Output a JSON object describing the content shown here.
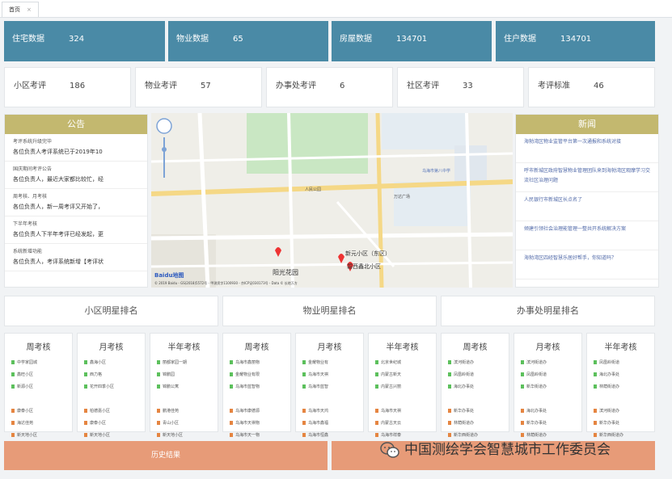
{
  "tab": {
    "label": "首页",
    "close": "×"
  },
  "stats": [
    {
      "label": "住宅数据",
      "value": "324"
    },
    {
      "label": "物业数据",
      "value": "65"
    },
    {
      "label": "房屋数据",
      "value": "134701"
    },
    {
      "label": "住户数据",
      "value": "134701"
    }
  ],
  "ratings": [
    {
      "label": "小区考评",
      "value": "186"
    },
    {
      "label": "物业考评",
      "value": "57"
    },
    {
      "label": "办事处考评",
      "value": "6"
    },
    {
      "label": "社区考评",
      "value": "33"
    },
    {
      "label": "考评标准",
      "value": "46"
    }
  ],
  "notice": {
    "title": "公告",
    "items": [
      {
        "title": "考评系统升级完毕",
        "desc": "各位负责人考评系统已于2019年10"
      },
      {
        "title": "国庆期间考评公告",
        "desc": "各位负责人，最近大家都比较忙，经"
      },
      {
        "title": "周考核、月考核",
        "desc": "各位负责人，新一周考评又开始了，"
      },
      {
        "title": "下半年考核",
        "desc": "各位负责人下半年考评已经发起，更"
      },
      {
        "title": "系统新增功能",
        "desc": "各位负责人，考评系统新增【考评状"
      }
    ]
  },
  "news": {
    "title": "新闻",
    "items": [
      "海勃湾区物业监管平台第一次通报和系统对接",
      "呼市新城区政府智慧物业管理团队来到海勃湾区观摩学习交流社区治理问题",
      "人民银行市新城区长点名了",
      "倾建引领社会治理能管理一整共开系统解决方案",
      "海勃湾区四经智慧乐居好帮手，你知道吗？"
    ]
  },
  "map": {
    "labels": [
      "阳光花园",
      "新元小区（东区）",
      "碧西鑫北小区",
      "乌海市第八中学",
      "万达广场",
      "人民公园"
    ],
    "copyright": "© 2019 Baidu - GS(2018)5572号 - 甲测资字1100930 - 京ICP证030173号 - Data © 长地万方",
    "logo": "Baidu地图"
  },
  "rank_heads": [
    "小区明星排名",
    "物业明星排名",
    "办事处明星排名"
  ],
  "rank_cols": [
    {
      "title": "周考核",
      "top": [
        "中学家园城",
        "鑫旺小区",
        "新源小区"
      ],
      "bottom": [
        "康泰小区",
        "海达佳苑",
        "新天地小区"
      ]
    },
    {
      "title": "月考核",
      "top": [
        "鑫海小区",
        "西力格",
        "花开四季小区"
      ],
      "bottom": [
        "柏德嘉小区",
        "康泰小区",
        "新天地小区"
      ]
    },
    {
      "title": "半年考核",
      "top": [
        "丽都家园一期",
        "锦鹏园",
        "锦鹏公寓"
      ],
      "bottom": [
        "鹏港佳苑",
        "青山小区",
        "新天地小区"
      ]
    },
    {
      "title": "周考核",
      "top": [
        "乌海市鑫丽物",
        "金耀物业有限",
        "乌海市蓝智物"
      ],
      "bottom": [
        "乌海市康德源",
        "乌海市天祺物",
        "乌海市天一物"
      ]
    },
    {
      "title": "月考核",
      "top": [
        "金耀物业有",
        "乌海市天祺",
        "乌海市蓝智"
      ],
      "bottom": [
        "乌海市天鸿",
        "乌海市鑫福",
        "乌海市恒鑫"
      ]
    },
    {
      "title": "半年考核",
      "top": [
        "北京世纪城",
        "内蒙古新天",
        "内蒙古兴丽"
      ],
      "bottom": [
        "乌海市天祺",
        "内蒙古天云",
        "乌海市祥泰"
      ]
    },
    {
      "title": "周考核",
      "top": [
        "滨河街道办",
        "凤凰岭街道",
        "海北办事处"
      ],
      "bottom": [
        "新华办事处",
        "林荫街道办",
        "新华西街道办"
      ]
    },
    {
      "title": "月考核",
      "top": [
        "滨河街道办",
        "凤凰岭街道",
        "新华街道办"
      ],
      "bottom": [
        "海北办事处",
        "新华办事处",
        "林荫街道办"
      ]
    },
    {
      "title": "半年考核",
      "top": [
        "凤凰岭街道",
        "海北办事处",
        "林荫街道办"
      ],
      "bottom": [
        "滨河街道办",
        "新华办事处",
        "新华西街道办"
      ]
    }
  ],
  "buttons": {
    "history": "历史结果",
    "other": ""
  },
  "watermark": "中国测绘学会智慧城市工作委员会",
  "colors": {
    "stat_bg": "#4a8aa6",
    "panel_head": "#c3b86f",
    "button": "#e79b78",
    "green_dot": "#5cc05c",
    "orange_dot": "#e58541"
  }
}
